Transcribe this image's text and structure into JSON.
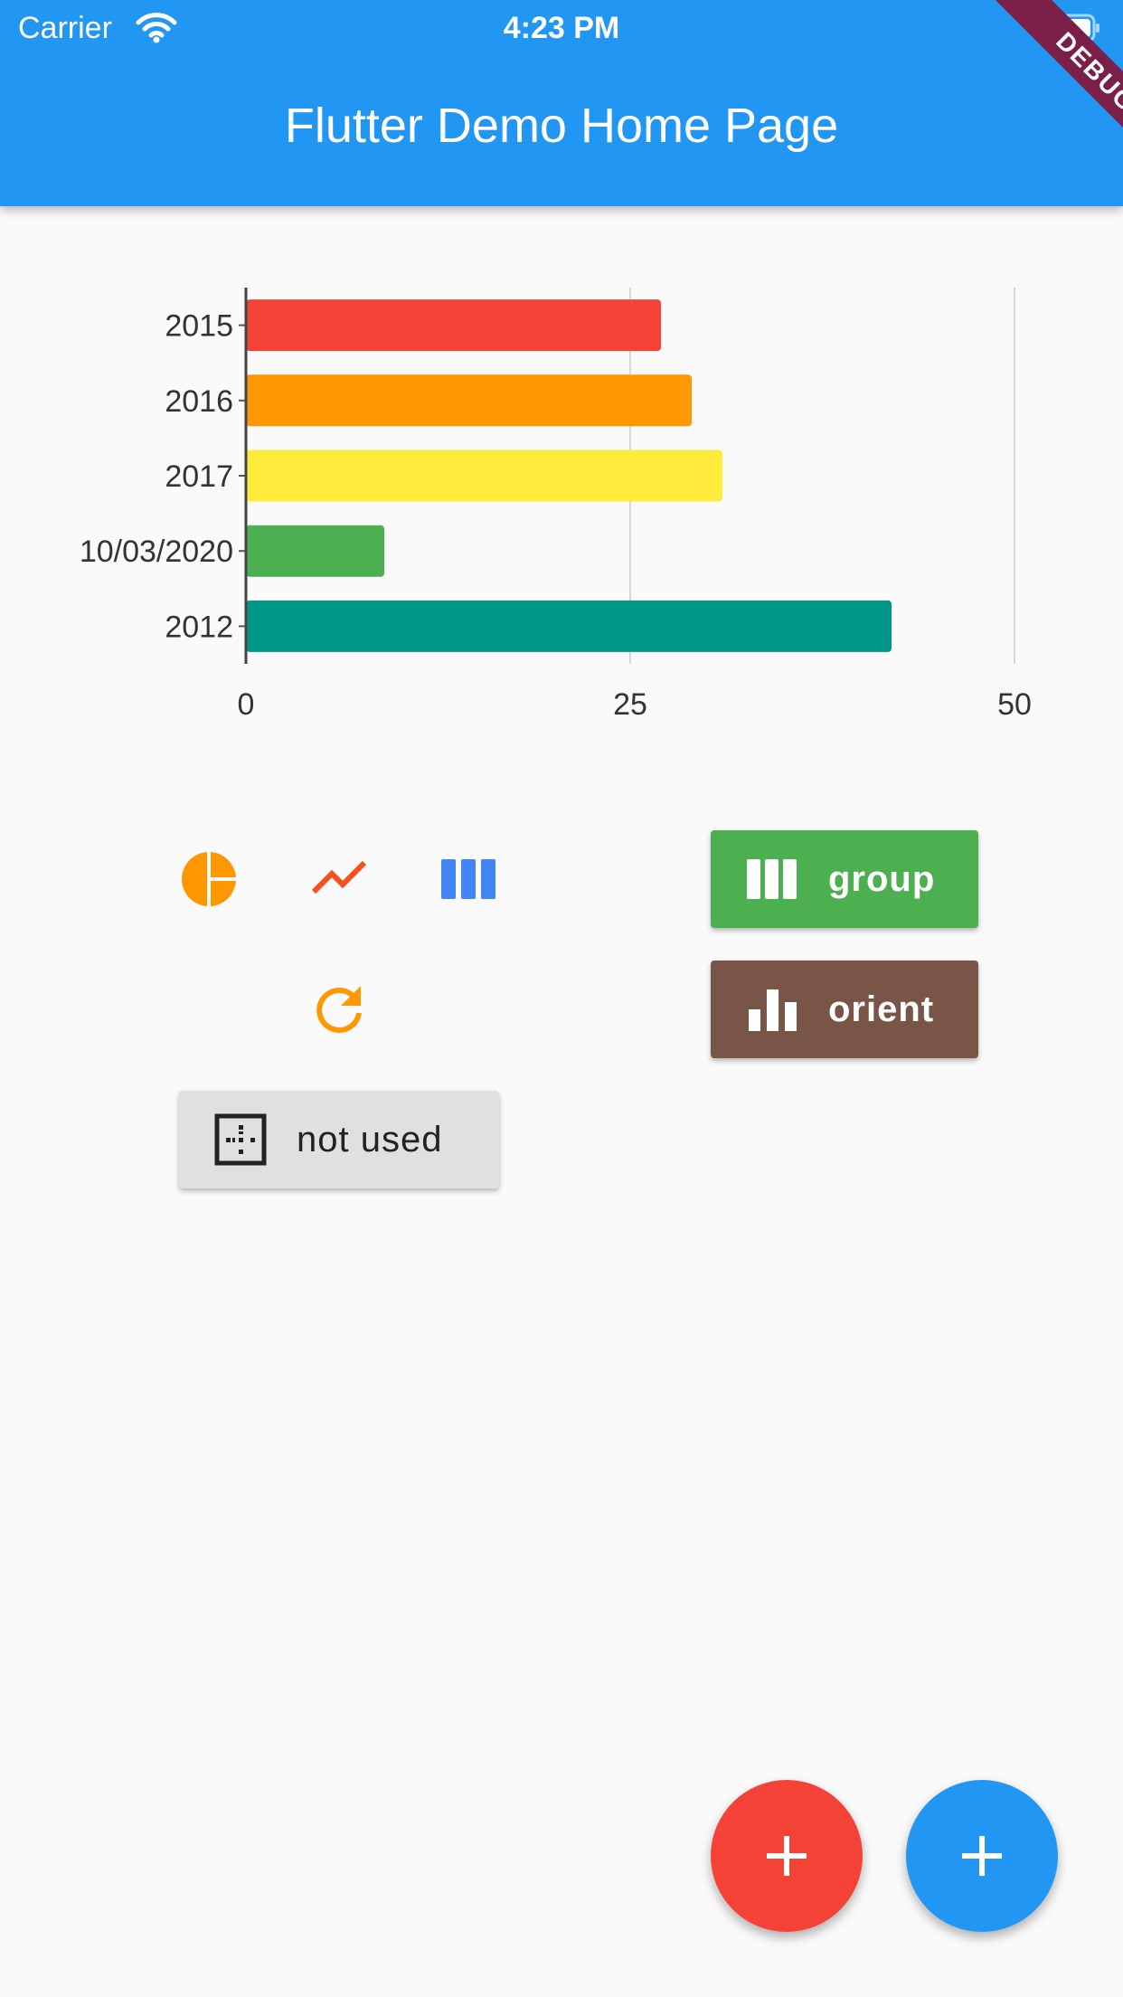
{
  "status_bar": {
    "carrier": "Carrier",
    "time": "4:23 PM"
  },
  "app_bar": {
    "title": "Flutter Demo Home Page"
  },
  "debug_banner": "DEBUG",
  "chart_data": {
    "type": "bar",
    "orientation": "horizontal",
    "categories": [
      "2015",
      "2016",
      "2017",
      "10/03/2020",
      "2012"
    ],
    "values": [
      27,
      29,
      31,
      9,
      42
    ],
    "colors": [
      "#f44336",
      "#ff9800",
      "#ffeb3b",
      "#4caf50",
      "#009688"
    ],
    "xlim": [
      0,
      50
    ],
    "x_ticks": [
      "0",
      "25",
      "50"
    ],
    "grid": true
  },
  "icon_buttons": [
    {
      "icon": "pie-chart-icon",
      "color": "#ff9800"
    },
    {
      "icon": "show-chart-icon",
      "color": "#f4511e"
    },
    {
      "icon": "view-column-icon",
      "color": "#4285f4"
    },
    {
      "icon": "refresh-icon",
      "color": "#ff9800"
    }
  ],
  "buttons": {
    "group": {
      "label": "group",
      "icon": "view-column-icon"
    },
    "orient": {
      "label": "orient",
      "icon": "bar-chart-icon"
    },
    "not_used": {
      "label": "not used",
      "icon": "border-inner-icon"
    }
  },
  "fabs": [
    {
      "icon": "add-icon",
      "color": "#f44336"
    },
    {
      "icon": "add-icon",
      "color": "#2196f3"
    }
  ]
}
